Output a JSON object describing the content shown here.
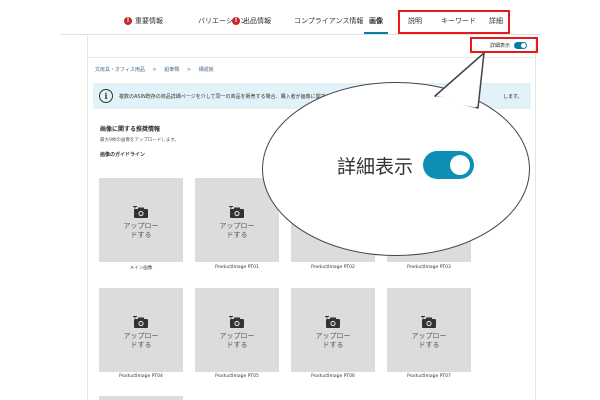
{
  "tabs": [
    {
      "label": "重要情報",
      "warning": true
    },
    {
      "label": "バリエーション",
      "warning": false
    },
    {
      "label": "出品情報",
      "warning": true
    },
    {
      "label": "コンプライアンス情報",
      "warning": false
    },
    {
      "label": "画像",
      "warning": false,
      "active": true
    },
    {
      "label": "説明",
      "warning": false
    },
    {
      "label": "キーワード",
      "warning": false
    },
    {
      "label": "詳細",
      "warning": false
    }
  ],
  "warning_glyph": "!",
  "detail_toggle": {
    "label": "詳細表示",
    "on": true
  },
  "breadcrumb": [
    "文房具・オフィス用品",
    ">",
    "鉛筆類",
    ">",
    "構成板"
  ],
  "notice": {
    "text": "複数のASIN既存の商品詳細ページを介して同一の商品を販売する場合、購入者が画像に関するより良い",
    "tail": "します。"
  },
  "section": {
    "title": "画像に関する推奨情報",
    "subtitle": "最大9枚の画像をアップロードします。",
    "guide": "画像のガイドライン"
  },
  "tiles": [
    {
      "upload": "アップロードする",
      "label": "メイン画像"
    },
    {
      "upload": "アップロードする",
      "label": "ProductImage PT01"
    },
    {
      "upload": "",
      "label": "ProductImage PT02"
    },
    {
      "upload": "",
      "label": "ProductImage PT03"
    },
    {
      "upload": "アップロードする",
      "label": "ProductImage PT04"
    },
    {
      "upload": "アップロードする",
      "label": "ProductImage PT05"
    },
    {
      "upload": "アップロードする",
      "label": "ProductImage PT06"
    },
    {
      "upload": "アップロードする",
      "label": "ProductImage PT07"
    }
  ],
  "callout": {
    "label": "詳細表示",
    "toggle_on": true
  },
  "colors": {
    "accent": "#0a7aa8",
    "highlight": "#e51a1a",
    "warning": "#c62828",
    "notice_bg": "#e3f1f8",
    "tile_bg": "#dcdcdc"
  }
}
